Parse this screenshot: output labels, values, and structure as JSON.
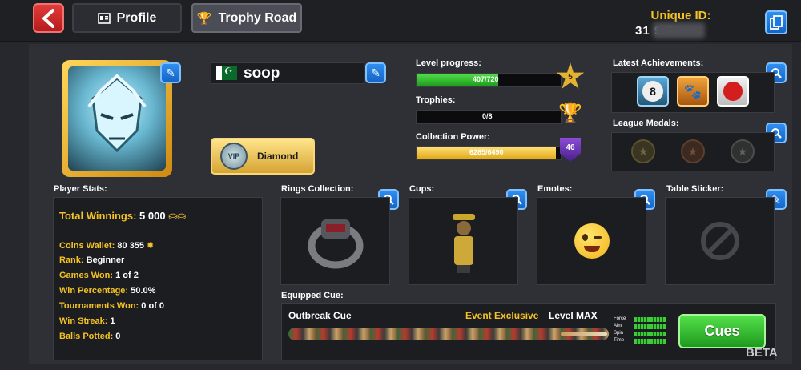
{
  "header": {
    "tabs": [
      {
        "label": "Profile"
      },
      {
        "label": "Trophy Road"
      }
    ],
    "unique_id_label": "Unique ID:",
    "unique_id_value": "31            9-7"
  },
  "profile": {
    "player_name": "soop",
    "vip_tier": "Diamond",
    "vip_badge": "VIP"
  },
  "progress": {
    "level_label": "Level progress:",
    "level_text": "407/720",
    "level_value": 407,
    "level_max": 720,
    "level_number": "5",
    "trophies_label": "Trophies:",
    "trophies_text": "0/8",
    "trophies_value": 0,
    "trophies_max": 8,
    "collection_label": "Collection Power:",
    "collection_text": "6285/6490",
    "collection_value": 6285,
    "collection_max": 6490,
    "collection_badge": "46"
  },
  "achievements": {
    "latest_label": "Latest Achievements:",
    "items": [
      "8-ball-icon",
      "paw-icon",
      "red-ball-icon"
    ],
    "league_label": "League Medals:"
  },
  "stats": {
    "title": "Player Stats:",
    "total_winnings_key": "Total Winnings:",
    "total_winnings_val": "5 000",
    "coins_key": "Coins Wallet:",
    "coins_val": "80 355",
    "rank_key": "Rank:",
    "rank_val": "Beginner",
    "games_key": "Games Won:",
    "games_val": "1 of 2",
    "winpct_key": "Win Percentage:",
    "winpct_val": "50.0%",
    "tourn_key": "Tournaments Won:",
    "tourn_val": "0 of 0",
    "streak_key": "Win Streak:",
    "streak_val": "1",
    "potted_key": "Balls Potted:",
    "potted_val": "0"
  },
  "collections": {
    "rings_label": "Rings Collection:",
    "cups_label": "Cups:",
    "emotes_label": "Emotes:",
    "sticker_label": "Table Sticker:"
  },
  "cue": {
    "section_label": "Equipped Cue:",
    "name": "Outbreak Cue",
    "exclusive": "Event Exclusive",
    "level": "Level MAX",
    "meters": [
      "Force",
      "Aim",
      "Spin",
      "Time"
    ],
    "button": "Cues"
  },
  "footer": {
    "beta": "BETA"
  },
  "colors": {
    "accent_gold": "#f5c323",
    "level_bar": "#2cc928",
    "collection_bar": "#f2c12e",
    "button_blue": "#1f78e0",
    "button_green": "#2fb52a",
    "back_red": "#d12a2a"
  }
}
